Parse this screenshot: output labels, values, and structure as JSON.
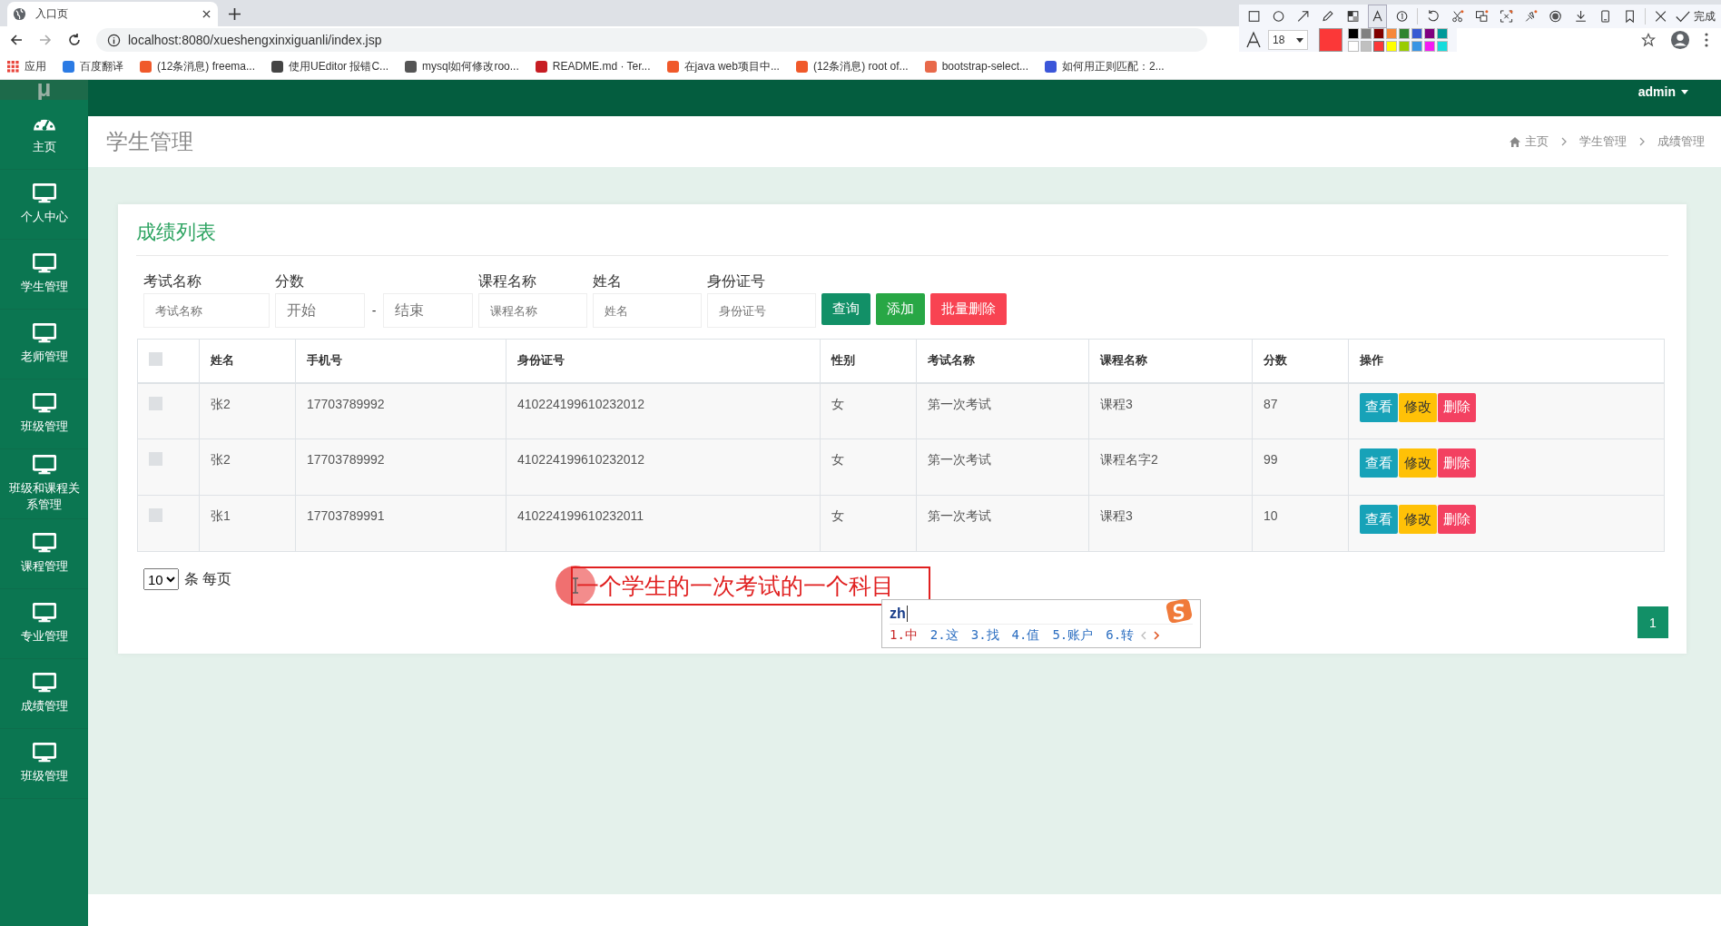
{
  "browser": {
    "tab_title": "入口页",
    "url": "localhost:8080/xueshengxinxiguanli/index.jsp",
    "bookmarks": [
      {
        "label": "应用",
        "color": "#e8453c"
      },
      {
        "label": "百度翻译",
        "color": "#2b7be4"
      },
      {
        "label": "(12条消息) freema...",
        "color": "#f0592a"
      },
      {
        "label": "使用UEditor 报错C...",
        "color": "#444444"
      },
      {
        "label": "mysql如何修改roo...",
        "color": "#555555"
      },
      {
        "label": "README.md · Ter...",
        "color": "#c71d23"
      },
      {
        "label": "在java web项目中...",
        "color": "#f0592a"
      },
      {
        "label": "(12条消息) root of...",
        "color": "#f0592a"
      },
      {
        "label": "bootstrap-select...",
        "color": "#e8694a"
      },
      {
        "label": "如何用正则匹配：2...",
        "color": "#3b56d9"
      }
    ]
  },
  "annotation_toolbar": {
    "tools": [
      {
        "kind": "rect",
        "selected": false
      },
      {
        "kind": "ellipse",
        "selected": false
      },
      {
        "kind": "arrow",
        "selected": false
      },
      {
        "kind": "pencil",
        "selected": false
      },
      {
        "kind": "mosaic",
        "selected": false
      },
      {
        "kind": "text",
        "selected": true
      },
      {
        "kind": "number",
        "selected": false
      },
      {
        "kind": "undo",
        "selected": false
      },
      {
        "kind": "scissors",
        "selected": false
      },
      {
        "kind": "translate",
        "selected": false
      },
      {
        "kind": "ocr",
        "selected": false
      },
      {
        "kind": "pin",
        "selected": false
      },
      {
        "kind": "record",
        "selected": false
      },
      {
        "kind": "download",
        "selected": false
      },
      {
        "kind": "phone",
        "selected": false
      },
      {
        "kind": "bookmark",
        "selected": false
      },
      {
        "kind": "close",
        "selected": false
      }
    ],
    "done_label": "完成",
    "font_size": "18",
    "palette": [
      {
        "color": "#000000",
        "selected": false
      },
      {
        "color": "#808080",
        "selected": false
      },
      {
        "color": "#800000",
        "selected": false
      },
      {
        "color": "#f7883a",
        "selected": false
      },
      {
        "color": "#308430",
        "selected": false
      },
      {
        "color": "#385ad3",
        "selected": false
      },
      {
        "color": "#800080",
        "selected": false
      },
      {
        "color": "#009999",
        "selected": false
      },
      {
        "color": "#ffffff",
        "selected": false
      },
      {
        "color": "#c0c0c0",
        "selected": false
      },
      {
        "color": "#fb3838",
        "selected": true
      },
      {
        "color": "#ffff00",
        "selected": false
      },
      {
        "color": "#99cc00",
        "selected": false
      },
      {
        "color": "#3894e4",
        "selected": false
      },
      {
        "color": "#f31bf3",
        "selected": false
      },
      {
        "color": "#16dcdc",
        "selected": false
      }
    ]
  },
  "header": {
    "logo": "μ",
    "user": "admin"
  },
  "sidebar": {
    "items": [
      {
        "label": "主页",
        "kind": "dashboard"
      },
      {
        "label": "个人中心",
        "kind": "monitor"
      },
      {
        "label": "学生管理",
        "kind": "monitor"
      },
      {
        "label": "老师管理",
        "kind": "monitor"
      },
      {
        "label": "班级管理",
        "kind": "monitor"
      },
      {
        "label": "班级和课程关系管理",
        "kind": "monitor"
      },
      {
        "label": "课程管理",
        "kind": "monitor"
      },
      {
        "label": "专业管理",
        "kind": "monitor"
      },
      {
        "label": "成绩管理",
        "kind": "monitor"
      },
      {
        "label": "班级管理",
        "kind": "monitor"
      }
    ]
  },
  "page_title": "学生管理",
  "breadcrumb": [
    "主页",
    "学生管理",
    "成绩管理"
  ],
  "card_title": "成绩列表",
  "filters": {
    "exam": {
      "label": "考试名称",
      "placeholder": "考试名称"
    },
    "score": {
      "label": "分数",
      "from_placeholder": "开始",
      "separator": "-",
      "to_placeholder": "结束"
    },
    "course": {
      "label": "课程名称",
      "placeholder": "课程名称"
    },
    "name": {
      "label": "姓名",
      "placeholder": "姓名"
    },
    "id_number": {
      "label": "身份证号",
      "placeholder": "身份证号"
    }
  },
  "buttons": [
    {
      "label": "查询",
      "kind": "search"
    },
    {
      "label": "添加",
      "kind": "add"
    },
    {
      "label": "批量删除",
      "kind": "delete"
    }
  ],
  "table": {
    "select_all": {
      "checked": false
    },
    "columns": [
      "姓名",
      "手机号",
      "身份证号",
      "性别",
      "考试名称",
      "课程名称",
      "分数",
      "操作"
    ],
    "rows": [
      {
        "checked": false,
        "cells": [
          "张2",
          "17703789992",
          "410224199610232012",
          "女",
          "第一次考试",
          "课程3",
          "87"
        ],
        "actions": [
          "查看",
          "修改",
          "删除"
        ]
      },
      {
        "checked": false,
        "cells": [
          "张2",
          "17703789992",
          "410224199610232012",
          "女",
          "第一次考试",
          "课程名字2",
          "99"
        ],
        "actions": [
          "查看",
          "修改",
          "删除"
        ]
      },
      {
        "checked": false,
        "cells": [
          "张1",
          "17703789991",
          "410224199610232011",
          "女",
          "第一次考试",
          "课程3",
          "10"
        ],
        "actions": [
          "查看",
          "修改",
          "删除"
        ]
      }
    ]
  },
  "page_size": {
    "value": "10",
    "suffix": "条 每页"
  },
  "pagination": [
    {
      "label": "1",
      "selected": true
    }
  ],
  "annotation_text": "一个学生的一次考试的一个科目",
  "ime": {
    "input": "zh",
    "candidates": [
      {
        "label": "1.中",
        "selected": true
      },
      {
        "label": "2.这",
        "selected": false
      },
      {
        "label": "3.找",
        "selected": false
      },
      {
        "label": "4.值",
        "selected": false
      },
      {
        "label": "5.账户",
        "selected": false
      },
      {
        "label": "6.转",
        "selected": false
      }
    ]
  }
}
